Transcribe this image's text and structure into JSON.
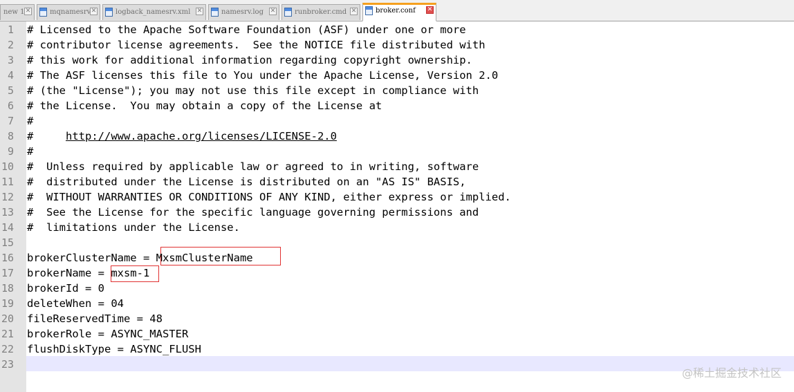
{
  "tabs": [
    {
      "label": "new 1",
      "active": false
    },
    {
      "label": "mqnamesrv",
      "active": false
    },
    {
      "label": "logback_namesrv.xml",
      "active": false
    },
    {
      "label": "namesrv.log",
      "active": false
    },
    {
      "label": "runbroker.cmd",
      "active": false
    },
    {
      "label": "broker.conf",
      "active": true
    }
  ],
  "close_glyph": "✕",
  "lines": [
    {
      "num": "1",
      "text": "# Licensed to the Apache Software Foundation (ASF) under one or more"
    },
    {
      "num": "2",
      "text": "# contributor license agreements.  See the NOTICE file distributed with"
    },
    {
      "num": "3",
      "text": "# this work for additional information regarding copyright ownership."
    },
    {
      "num": "4",
      "text": "# The ASF licenses this file to You under the Apache License, Version 2.0"
    },
    {
      "num": "5",
      "text": "# (the \"License\"); you may not use this file except in compliance with"
    },
    {
      "num": "6",
      "text": "# the License.  You may obtain a copy of the License at"
    },
    {
      "num": "7",
      "text": "#"
    },
    {
      "num": "8",
      "text": "#     ",
      "url": "http://www.apache.org/licenses/LICENSE-2.0"
    },
    {
      "num": "9",
      "text": "#"
    },
    {
      "num": "10",
      "text": "#  Unless required by applicable law or agreed to in writing, software"
    },
    {
      "num": "11",
      "text": "#  distributed under the License is distributed on an \"AS IS\" BASIS,"
    },
    {
      "num": "12",
      "text": "#  WITHOUT WARRANTIES OR CONDITIONS OF ANY KIND, either express or implied."
    },
    {
      "num": "13",
      "text": "#  See the License for the specific language governing permissions and"
    },
    {
      "num": "14",
      "text": "#  limitations under the License."
    },
    {
      "num": "15",
      "text": ""
    },
    {
      "num": "16",
      "text": "brokerClusterName = MxsmClusterName"
    },
    {
      "num": "17",
      "text": "brokerName = mxsm-1"
    },
    {
      "num": "18",
      "text": "brokerId = 0"
    },
    {
      "num": "19",
      "text": "deleteWhen = 04"
    },
    {
      "num": "20",
      "text": "fileReservedTime = 48"
    },
    {
      "num": "21",
      "text": "brokerRole = ASYNC_MASTER"
    },
    {
      "num": "22",
      "text": "flushDiskType = ASYNC_FLUSH"
    },
    {
      "num": "23",
      "text": ""
    }
  ],
  "current_line": "23",
  "watermark": "@稀土掘金技术社区",
  "colors": {
    "active_tab_accent": "#f5a01e",
    "highlight_box": "#e03030",
    "current_line_bg": "#e8e8ff"
  }
}
